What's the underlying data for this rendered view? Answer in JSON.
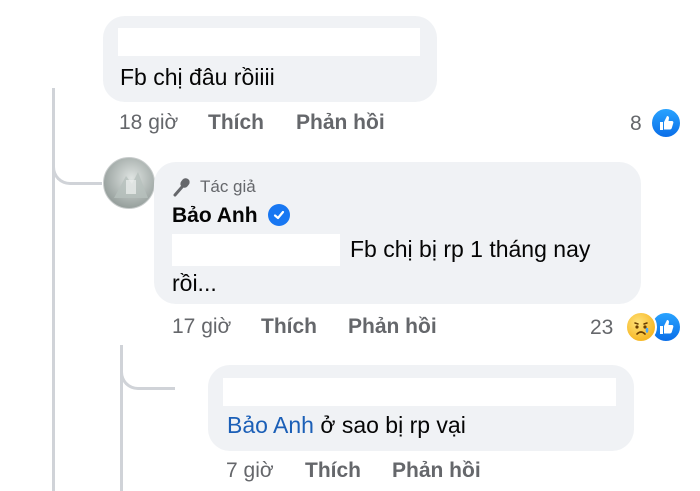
{
  "comment1": {
    "text": "Fb chị đâu rồiiii",
    "time": "18 giờ",
    "like_label": "Thích",
    "reply_label": "Phản hồi",
    "reaction_count": "8",
    "reaction_icon": "like-icon"
  },
  "comment2": {
    "author_badge": "Tác giả",
    "author_name": "Bảo Anh",
    "text_line1": "Fb chị bị rp 1 tháng nay",
    "text_line2": "rồi...",
    "time": "17 giờ",
    "like_label": "Thích",
    "reply_label": "Phản hồi",
    "reaction_count": "23",
    "reaction_icons": [
      "sad-icon",
      "like-icon"
    ]
  },
  "comment3": {
    "mention": "Bảo Anh",
    "text": " ở sao bị rp vại",
    "time": "7 giờ",
    "like_label": "Thích",
    "reply_label": "Phản hồi"
  },
  "colors": {
    "bubble": "#f0f2f5",
    "meta_text": "#65676b",
    "mention": "#1b5fb7",
    "like_blue": "#1877f2"
  }
}
